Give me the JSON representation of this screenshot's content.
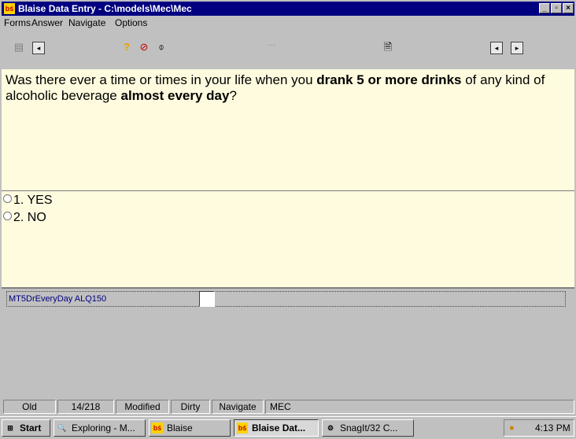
{
  "window": {
    "title": "Blaise Data Entry - C:\\models\\Mec\\Mec",
    "icon": "blaise-icon"
  },
  "menu": [
    "Forms",
    "Answer",
    "Navigate",
    "Options"
  ],
  "question": {
    "part1": "Was there ever a time or times in your life when you ",
    "bold1": "drank 5 or more drinks",
    "part2": " of any kind of alcoholic beverage ",
    "bold2": "almost every day",
    "part3": "?"
  },
  "answers": [
    "1. YES",
    "2. NO"
  ],
  "field": {
    "name": "MT5DrEveryDay ALQ150",
    "value": ""
  },
  "status": [
    "Old",
    "14/218",
    "Modified",
    "Dirty",
    "Navigate",
    "MEC"
  ],
  "taskbar": {
    "start": "Start",
    "buttons": [
      "Exploring - M...",
      "Blaise",
      "Blaise Dat...",
      "SnagIt/32 C..."
    ],
    "time": "4:13 PM"
  }
}
